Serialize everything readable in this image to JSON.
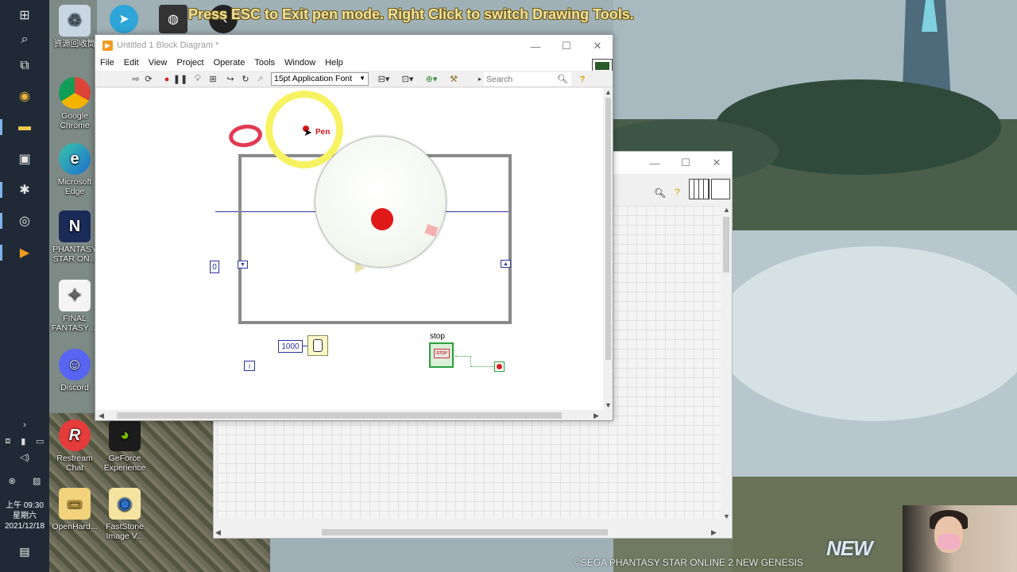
{
  "banner": {
    "text": "Press ESC to Exit pen mode.  Right Click to switch Drawing Tools."
  },
  "taskbar": {
    "clock_time": "上午 09:30",
    "clock_day": "星期六",
    "clock_date": "2021/12/18"
  },
  "desktop_icons": [
    {
      "label": "資源回收筒",
      "icon": "recycle-bin-icon"
    },
    {
      "label": "Google Chrome",
      "icon": "chrome-icon"
    },
    {
      "label": "Microsoft Edge",
      "icon": "edge-icon"
    },
    {
      "label": "PHANTASY STAR ON...",
      "icon": "pso2-icon"
    },
    {
      "label": "FINAL FANTASY ...",
      "icon": "ffxiv-icon"
    },
    {
      "label": "Discord",
      "icon": "discord-icon"
    },
    {
      "label": "Restream Chat",
      "icon": "restream-icon"
    },
    {
      "label": "GeForce Experience",
      "icon": "nvidia-icon"
    },
    {
      "label": "OpenHard...",
      "icon": "folder-icon"
    },
    {
      "label": "FastStone Image V...",
      "icon": "faststone-icon"
    }
  ],
  "block_diagram": {
    "title": "Untitled 1 Block Diagram *",
    "menu": [
      "File",
      "Edit",
      "View",
      "Project",
      "Operate",
      "Tools",
      "Window",
      "Help"
    ],
    "font_select": "15pt Application Font",
    "search_placeholder": "Search",
    "nodes": {
      "zero_const": "0",
      "wait_const": "1000",
      "iteration": "i",
      "stop_label": "stop",
      "stop_button": "STOP"
    }
  },
  "pen": {
    "label": "Pen"
  },
  "watermark": "©SEGA PHANTASY STAR ONLINE 2 NEW GENESIS",
  "game_logo": "NEW",
  "colors": {
    "pen_red": "#d51515",
    "cursor_ring": "#f7f261",
    "wire_blue": "#2a34a0"
  }
}
